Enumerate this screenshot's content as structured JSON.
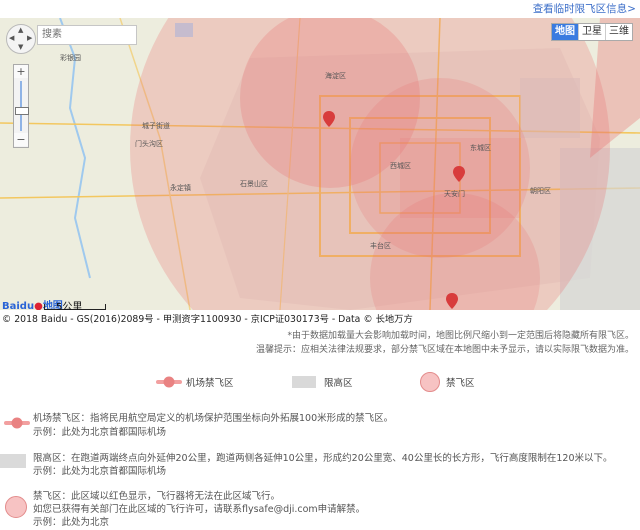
{
  "header": {
    "link": "查看临时限飞区信息>"
  },
  "map": {
    "search_placeholder": "搜素",
    "types": [
      "地图",
      "卫星",
      "三维"
    ],
    "active_type": "地图",
    "zoom_in": "+",
    "zoom_out": "−",
    "scale_label": "5公里",
    "logo_text": "Baidu",
    "logo_sub": "地图",
    "place_labels": [
      "彩银园",
      "城子街道",
      "门头沟区",
      "永定镇",
      "石景山区",
      "海淀区",
      "西城区",
      "东城区",
      "朝阳区",
      "丰台区",
      "天安门"
    ],
    "colors": {
      "nofly": "#e87474",
      "height": "#d4d4d4",
      "water": "#9fc9ee",
      "road": "#f3c75f",
      "marker": "#d83c3c"
    }
  },
  "copyright": "© 2018 Baidu - GS(2016)2089号 - 甲测资字1100930 - 京ICP证030173号 - Data © 长地万方",
  "notes": [
    "*由于数据加载量大会影响加载时间，地图比例尺缩小到一定范围后将隐藏所有限飞区。",
    "温馨提示：应相关法律法规要求，部分禁飞区域在本地图中未予显示，请以实际限飞数据为准。"
  ],
  "legend": {
    "airport": "机场禁飞区",
    "height": "限高区",
    "nofly": "禁飞区"
  },
  "descriptions": [
    {
      "line1": "机场禁飞区：指将民用航空局定义的机场保护范围坐标向外拓展100米形成的禁飞区。",
      "line2": "示例：此处为北京首都国际机场"
    },
    {
      "line1": "限高区：在跑道两端终点向外延伸20公里，跑道两侧各延伸10公里，形成约20公里宽、40公里长的长方形，飞行高度限制在120米以下。",
      "line2": "示例：此处为北京首都国际机场"
    },
    {
      "line1": "禁飞区：此区域以红色显示，飞行器将无法在此区域飞行。",
      "line2": "如您已获得有关部门在此区域的飞行许可，请联系flysafe@dji.com申请解禁。",
      "line3": "示例：此处为北京"
    }
  ]
}
